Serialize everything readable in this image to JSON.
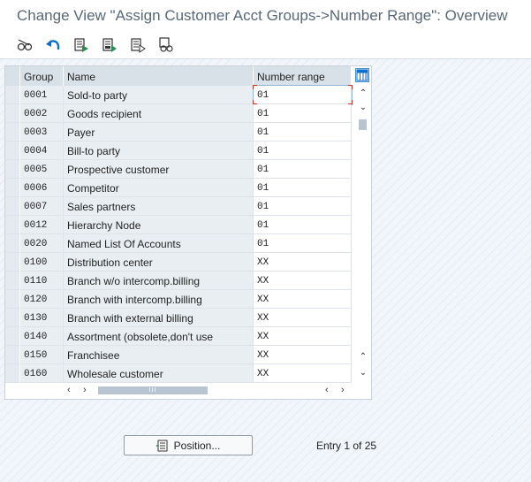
{
  "window": {
    "title": "Change View \"Assign Customer Acct Groups->Number Range\": Overview"
  },
  "toolbar": {
    "buttons": [
      {
        "icon": "glasses-display-change-icon"
      },
      {
        "icon": "undo-icon"
      },
      {
        "icon": "select-all-icon"
      },
      {
        "icon": "select-block-icon"
      },
      {
        "icon": "deselect-all-icon"
      },
      {
        "icon": "print-preview-icon"
      }
    ]
  },
  "table": {
    "columns": {
      "group": "Group",
      "name": "Name",
      "number_range": "Number range"
    },
    "rows": [
      {
        "group": "0001",
        "name": "Sold-to party",
        "number_range": "01"
      },
      {
        "group": "0002",
        "name": "Goods recipient",
        "number_range": "01"
      },
      {
        "group": "0003",
        "name": "Payer",
        "number_range": "01"
      },
      {
        "group": "0004",
        "name": "Bill-to party",
        "number_range": "01"
      },
      {
        "group": "0005",
        "name": "Prospective customer",
        "number_range": "01"
      },
      {
        "group": "0006",
        "name": "Competitor",
        "number_range": "01"
      },
      {
        "group": "0007",
        "name": "Sales partners",
        "number_range": "01"
      },
      {
        "group": "0012",
        "name": "Hierarchy Node",
        "number_range": "01"
      },
      {
        "group": "0020",
        "name": "Named List Of Accounts",
        "number_range": "01"
      },
      {
        "group": "0100",
        "name": "Distribution center",
        "number_range": "XX"
      },
      {
        "group": "0110",
        "name": "Branch w/o intercomp.billing",
        "number_range": "XX"
      },
      {
        "group": "0120",
        "name": "Branch with intercomp.billing",
        "number_range": "XX"
      },
      {
        "group": "0130",
        "name": "Branch with external billing",
        "number_range": "XX"
      },
      {
        "group": "0140",
        "name": "Assortment (obsolete,don't use",
        "number_range": "XX"
      },
      {
        "group": "0150",
        "name": "Franchisee",
        "number_range": "XX"
      },
      {
        "group": "0160",
        "name": "Wholesale customer",
        "number_range": "XX"
      }
    ]
  },
  "footer": {
    "position_button_label": "Position...",
    "entry_info": "Entry 1 of 25"
  },
  "colors": {
    "accent": "#0a6ed1",
    "title_text": "#5a6875",
    "focus_marker": "#c0392b"
  }
}
